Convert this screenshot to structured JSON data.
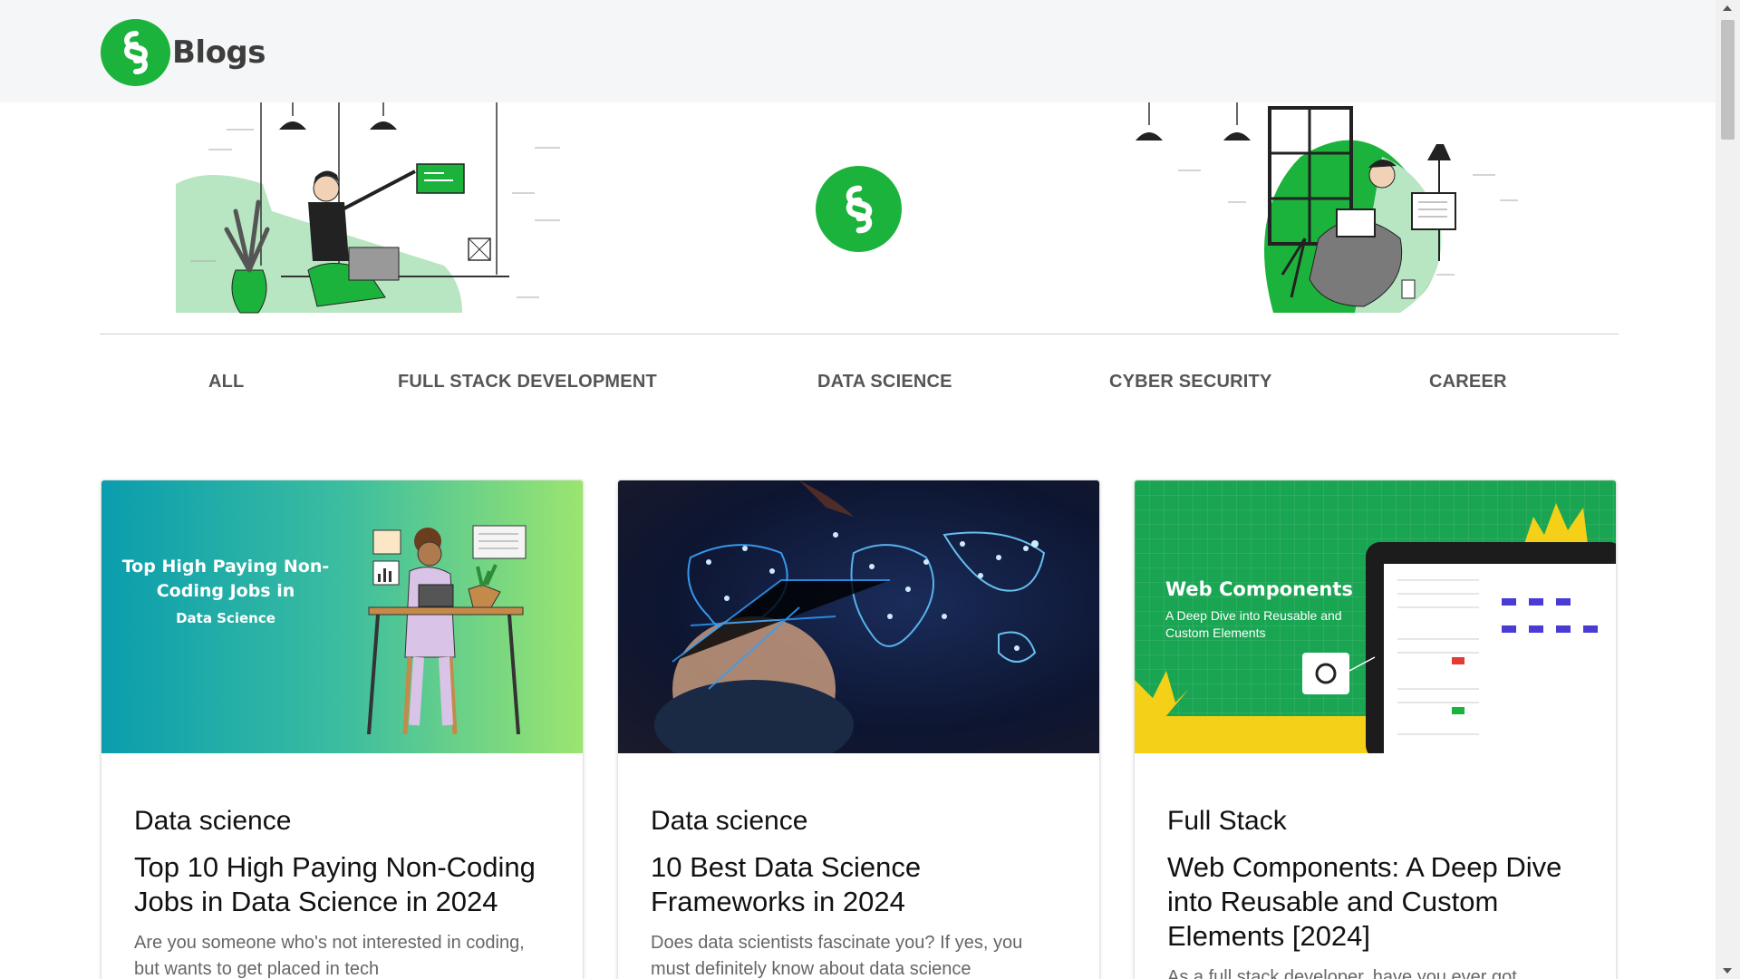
{
  "header": {
    "logo_icon": "link-chain-logo-icon",
    "brand_text": "Blogs"
  },
  "tabs": [
    {
      "label": "ALL"
    },
    {
      "label": "FULL STACK DEVELOPMENT"
    },
    {
      "label": "DATA SCIENCE"
    },
    {
      "label": "CYBER SECURITY"
    },
    {
      "label": "CAREER"
    }
  ],
  "cards": [
    {
      "image": {
        "headline_line1": "Top High Paying Non-",
        "headline_line2": "Coding Jobs in",
        "headline_line3": "Data Science"
      },
      "category": "Data science",
      "title": "Top 10 High Paying Non-Coding Jobs in Data Science in 2024",
      "description": "Are you someone who's not interested in coding, but wants to get placed in tech"
    },
    {
      "image": {},
      "category": "Data science",
      "title": "10 Best Data Science Frameworks in 2024",
      "description": "Does data scientists fascinate you? If yes, you must definitely know about data science"
    },
    {
      "image": {
        "headline": "Web Components",
        "subline1": "A Deep Dive into Reusable and",
        "subline2": "Custom Elements"
      },
      "category": "Full Stack",
      "title": "Web Components: A Deep Dive into Reusable and Custom Elements [2024]",
      "description": "As a full stack developer, have you ever got"
    }
  ],
  "colors": {
    "brand_green": "#1bb33b",
    "header_bg": "#f5f6f7",
    "tab_text": "#555555"
  }
}
